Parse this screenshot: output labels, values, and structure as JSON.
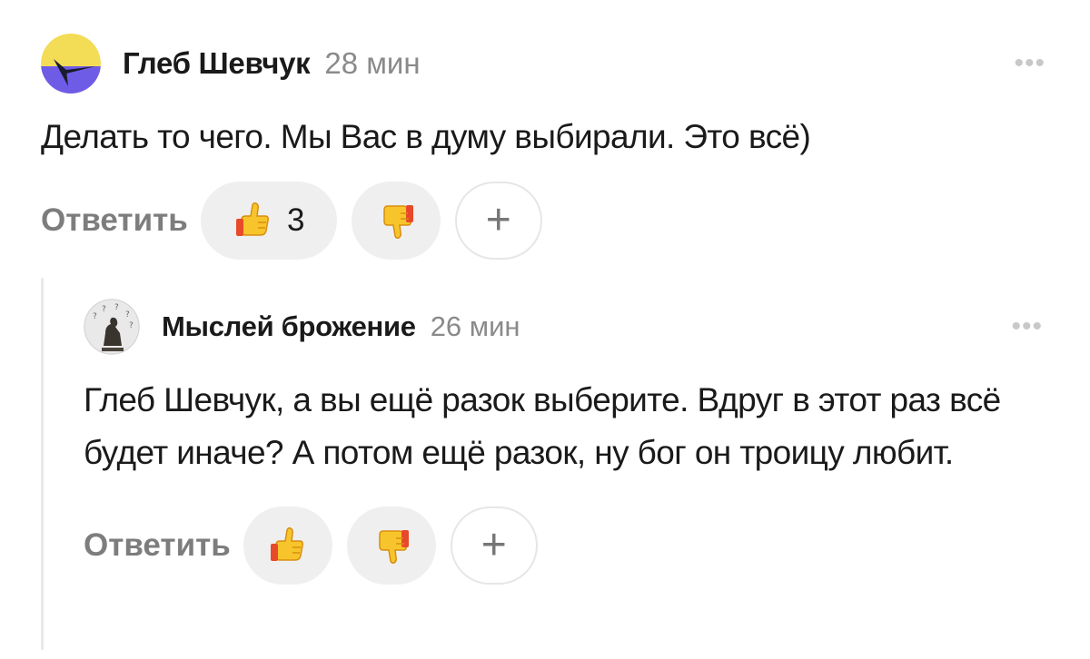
{
  "comments": [
    {
      "author": "Глеб Шевчук",
      "time": "28 мин",
      "text": "Делать то чего. Мы Вас в думу выбирали. Это всё)",
      "reply_label": "Ответить",
      "like_count": "3",
      "avatar_icon": "yellow-purple-avatar",
      "more_icon": "ellipsis-icon"
    },
    {
      "author": "Мыслей брожение",
      "time": "26 мин",
      "text": "Глеб Шевчук, а вы ещё разок выберите. Вдруг в этот раз всё будет иначе? А потом ещё разок, ну бог он троицу любит.",
      "reply_label": "Ответить",
      "like_count": "",
      "avatar_icon": "thinker-statue-avatar",
      "more_icon": "ellipsis-icon"
    }
  ],
  "icons": {
    "like": "thumbs-up-icon",
    "dislike": "thumbs-down-icon",
    "add": "plus-icon",
    "more": "ellipsis-icon"
  },
  "glyphs": {
    "more": "•••",
    "plus": "+"
  },
  "colors": {
    "reaction_bg": "#efefef",
    "muted_text": "#8a8a8a",
    "reply_text": "#7d7d7d",
    "thread_line": "#e8e8e8",
    "avatar_yellow": "#f3dc56",
    "avatar_purple": "#6f5ce6"
  }
}
